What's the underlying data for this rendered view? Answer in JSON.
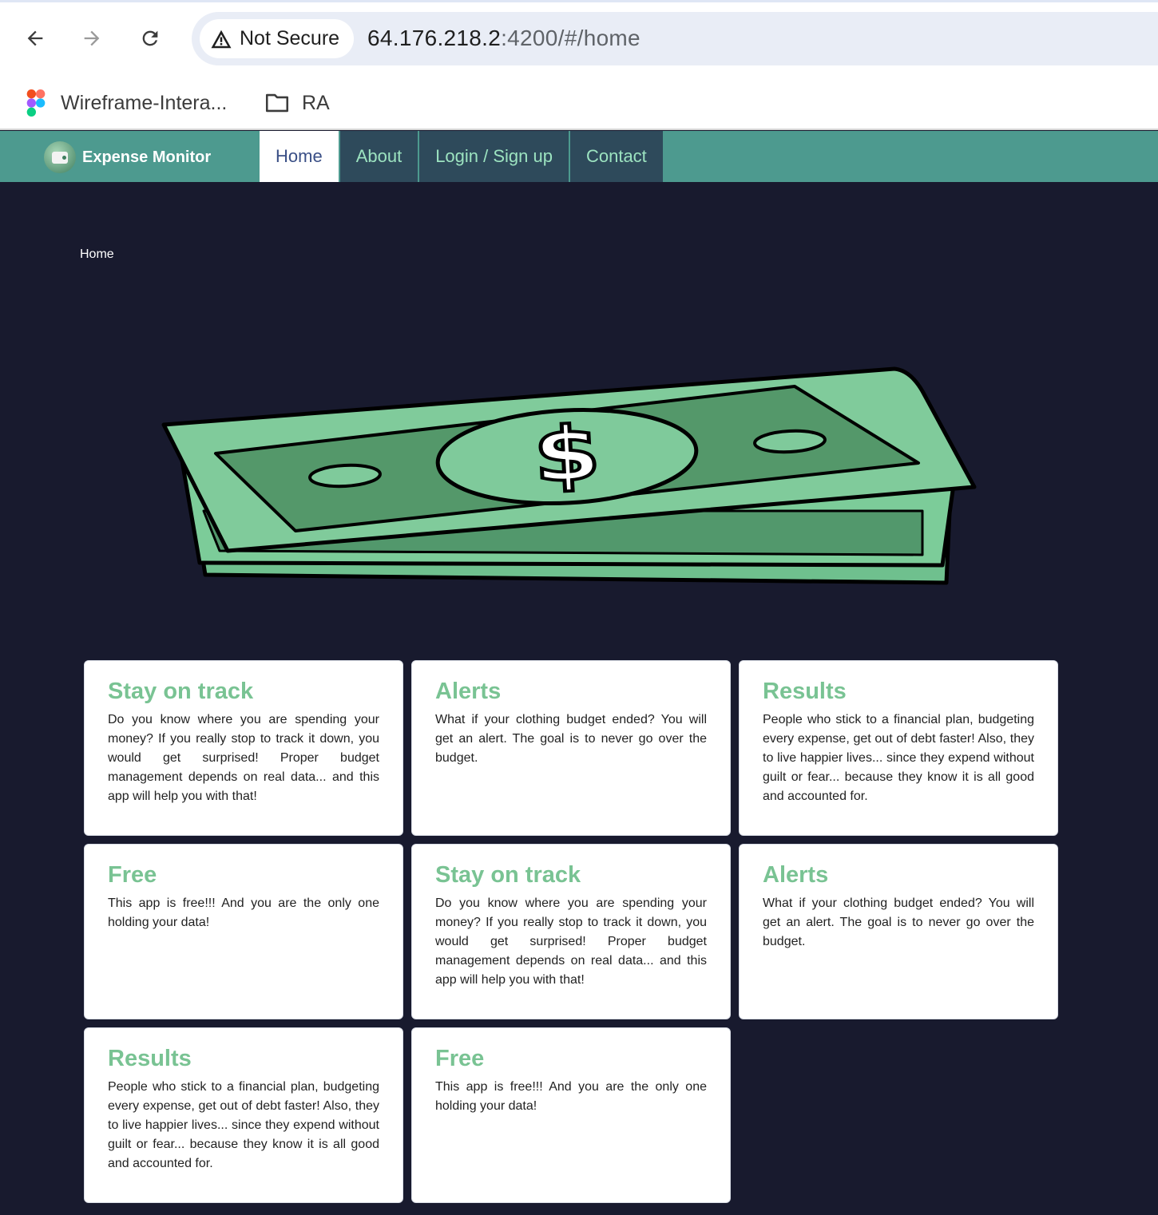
{
  "browser": {
    "security_label": "Not Secure",
    "url_host": "64.176.218.2",
    "url_path": ":4200/#/home",
    "bookmarks": [
      {
        "label": "Wireframe-Intera...",
        "icon": "figma-icon"
      },
      {
        "label": "RA",
        "icon": "folder-icon"
      }
    ]
  },
  "app": {
    "brand": "Expense Monitor",
    "tabs": [
      {
        "label": "Home",
        "active": true
      },
      {
        "label": "About",
        "active": false
      },
      {
        "label": "Login / Sign up",
        "active": false
      },
      {
        "label": "Contact",
        "active": false
      }
    ],
    "colors": {
      "navbar": "#4d9a8f",
      "tab_bg": "#2e4a5b",
      "tab_text": "#9ce3c0",
      "active_tab_text": "#3a4f86",
      "page_bg": "#181a2e",
      "card_title": "#79c393"
    }
  },
  "main": {
    "breadcrumb": "Home",
    "hero_icon": "money-stack-icon",
    "cards": [
      {
        "title": "Stay on track",
        "text": "Do you know where you are spending your money? If you really stop to track it down, you would get surprised! Proper budget management depends on real data... and this app will help you with that!"
      },
      {
        "title": "Alerts",
        "text": "What if your clothing budget ended? You will get an alert. The goal is to never go over the budget."
      },
      {
        "title": "Results",
        "text": "People who stick to a financial plan, budgeting every expense, get out of debt faster! Also, they to live happier lives... since they expend without guilt or fear... because they know it is all good and accounted for."
      },
      {
        "title": "Free",
        "text": "This app is free!!! And you are the only one holding your data!"
      },
      {
        "title": "Stay on track",
        "text": "Do you know where you are spending your money? If you really stop to track it down, you would get surprised! Proper budget management depends on real data... and this app will help you with that!"
      },
      {
        "title": "Alerts",
        "text": "What if your clothing budget ended? You will get an alert. The goal is to never go over the budget."
      },
      {
        "title": "Results",
        "text": "People who stick to a financial plan, budgeting every expense, get out of debt faster! Also, they to live happier lives... since they expend without guilt or fear... because they know it is all good and accounted for."
      },
      {
        "title": "Free",
        "text": "This app is free!!! And you are the only one holding your data!"
      }
    ]
  }
}
